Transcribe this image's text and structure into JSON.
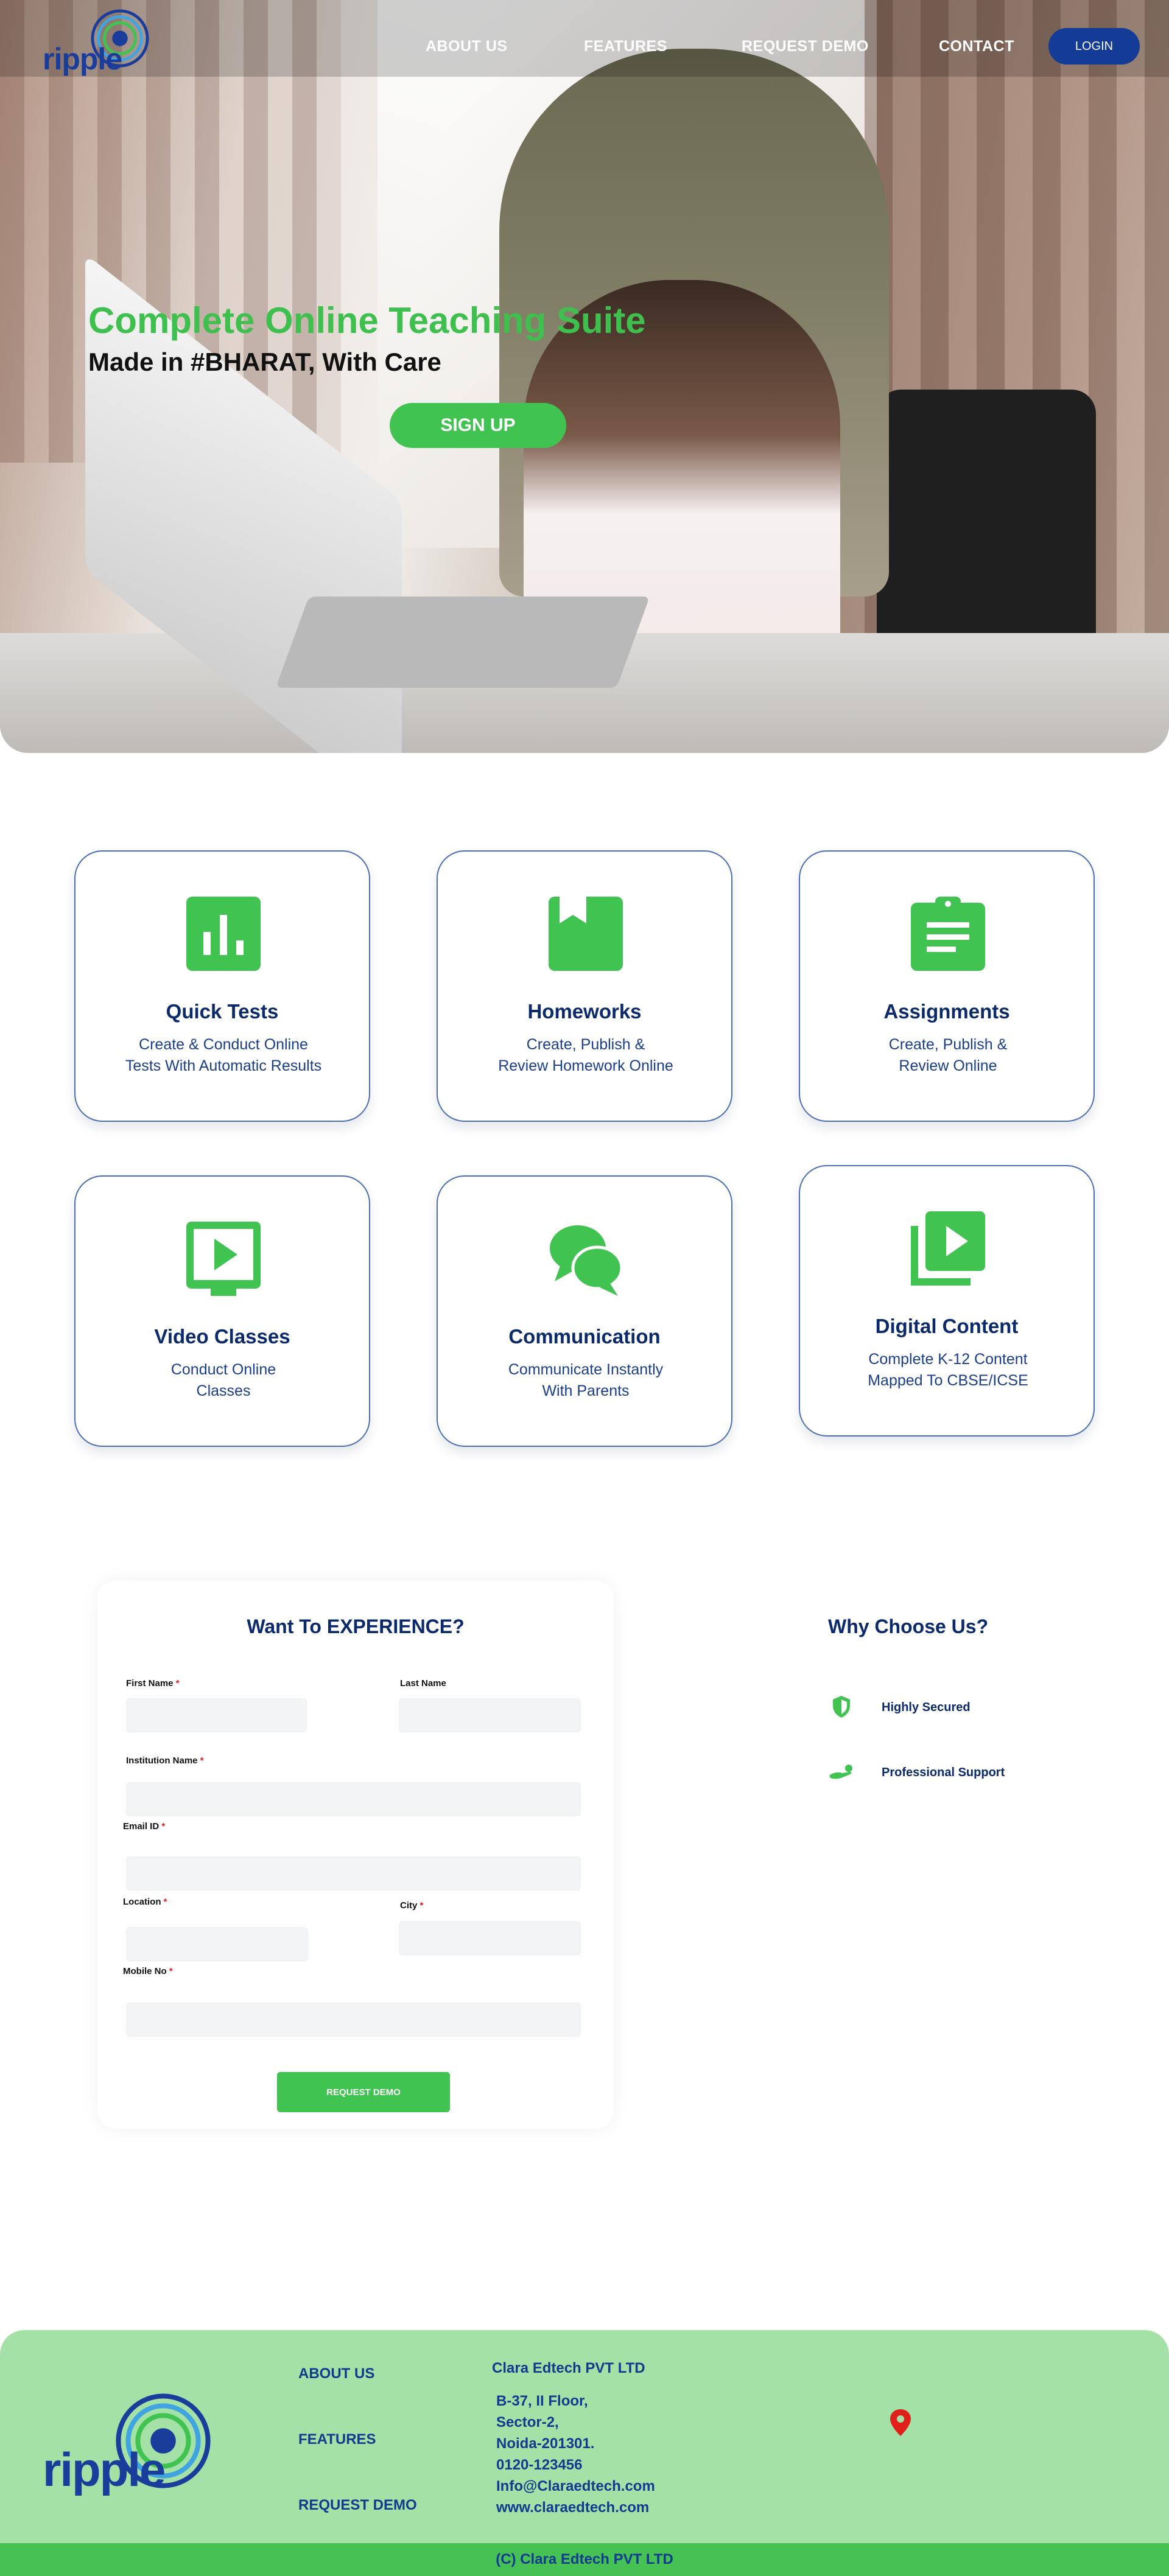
{
  "brand": {
    "name": "ripple",
    "accent": "#41c352",
    "primary": "#0b2a6b"
  },
  "nav": {
    "links": [
      "ABOUT US",
      "FEATURES",
      "REQUEST DEMO",
      "CONTACT"
    ],
    "login": "LOGIN"
  },
  "hero": {
    "title": "Complete Online Teaching Suite",
    "subtitle": "Made in #BHARAT, With Care",
    "cta": "SIGN UP"
  },
  "features": [
    {
      "icon": "bar-chart-icon",
      "title": "Quick Tests",
      "desc": [
        "Create & Conduct Online",
        "Tests With Automatic Results"
      ]
    },
    {
      "icon": "book-icon",
      "title": "Homeworks",
      "desc": [
        "Create, Publish &",
        "Review Homework Online"
      ]
    },
    {
      "icon": "clipboard-icon",
      "title": "Assignments",
      "desc": [
        "Create, Publish &",
        "Review Online"
      ]
    },
    {
      "icon": "video-icon",
      "title": "Video Classes",
      "desc": [
        "Conduct Online",
        "Classes"
      ]
    },
    {
      "icon": "chat-icon",
      "title": "Communication",
      "desc": [
        "Communicate Instantly",
        "With Parents"
      ]
    },
    {
      "icon": "video-library-icon",
      "title": "Digital Content",
      "desc": [
        "Complete K-12 Content",
        "Mapped To CBSE/ICSE"
      ]
    }
  ],
  "form": {
    "title": "Want To EXPERIENCE?",
    "fields": {
      "first_name": "First Name",
      "last_name": "Last Name",
      "institution": "Institution Name",
      "email": "Email ID",
      "location": "Location",
      "city": "City",
      "mobile": "Mobile No"
    },
    "required_mark": "*",
    "submit": "REQUEST DEMO"
  },
  "why": {
    "title": "Why Choose Us?",
    "items": [
      {
        "icon": "shield-icon",
        "label": "Highly Secured"
      },
      {
        "icon": "support-hand-icon",
        "label": "Professional Support"
      }
    ]
  },
  "footer": {
    "links": [
      "ABOUT US",
      "FEATURES",
      "REQUEST DEMO"
    ],
    "company": "Clara Edtech PVT LTD",
    "address": [
      "B-37, II Floor,",
      "Sector-2,",
      "Noida-201301.",
      "0120-123456",
      "Info@Claraedtech.com",
      "www.claraedtech.com"
    ],
    "copyright": "(C) Clara Edtech PVT LTD"
  }
}
